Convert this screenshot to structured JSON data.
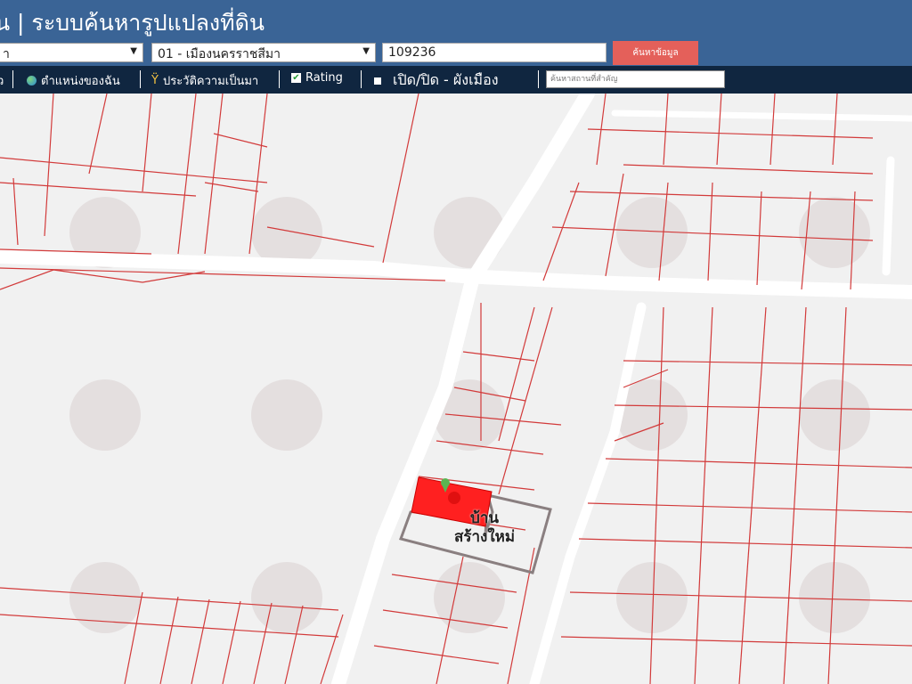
{
  "header": {
    "title": "น | ระบบค้นหารูปแปลงที่ดิน",
    "province_select": "า",
    "district_select": "01 - เมืองนครราชสีมา",
    "parcel_number": "109236",
    "search_button": "ค้นหาข้อมูล"
  },
  "toolbar": {
    "item0": "ว",
    "my_location": "ตำแหน่งของฉัน",
    "history": "ประวัติความเป็นมา",
    "rating": "Rating",
    "toggle_layer": "เปิด/ปิด - ผังเมือง",
    "place_search_placeholder": "ค้นหาสถานที่สำคัญ"
  },
  "map": {
    "label": "บ้าน\nสร้างใหม่",
    "highlight_color": "#ff2020",
    "boundary_color": "#d23a3a",
    "road_color": "#ffffff"
  }
}
